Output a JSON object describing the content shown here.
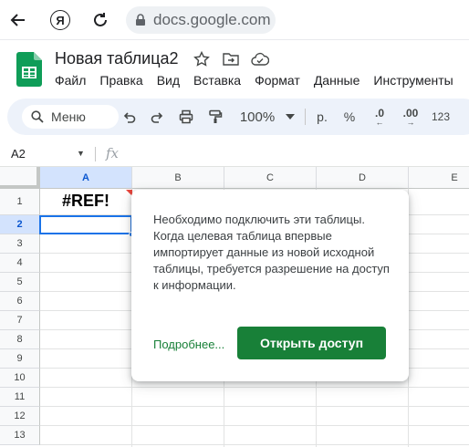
{
  "browser": {
    "url": "docs.google.com",
    "yandex_glyph": "Я"
  },
  "header": {
    "title": "Новая таблица2",
    "menu": [
      "Файл",
      "Правка",
      "Вид",
      "Вставка",
      "Формат",
      "Данные",
      "Инструменты"
    ]
  },
  "toolbar": {
    "search_label": "Меню",
    "zoom": "100%",
    "currency_label": "р.",
    "percent_label": "%",
    "decrease_decimals": ".0",
    "increase_decimals": ".00",
    "number_format": "123"
  },
  "formula_bar": {
    "cell_ref": "A2",
    "fx_label": "fx"
  },
  "grid": {
    "columns": [
      "A",
      "B",
      "C",
      "D",
      "E"
    ],
    "rows": [
      "1",
      "2",
      "3",
      "4",
      "5",
      "6",
      "7",
      "8",
      "9",
      "10",
      "11",
      "12",
      "13"
    ],
    "selected_column": "A",
    "selected_row": "2",
    "cell_a1": "#REF!"
  },
  "popup": {
    "message": "Необходимо подключить эти таблицы. Когда целевая таблица впервые импортирует данные из новой исходной таблицы, требуется разрешение на доступ к информации.",
    "learn_more": "Подробнее...",
    "allow_button": "Открыть доступ"
  },
  "colors": {
    "accent_green": "#188038",
    "selection_blue": "#1a73e8",
    "error_flag": "#e8453c"
  }
}
